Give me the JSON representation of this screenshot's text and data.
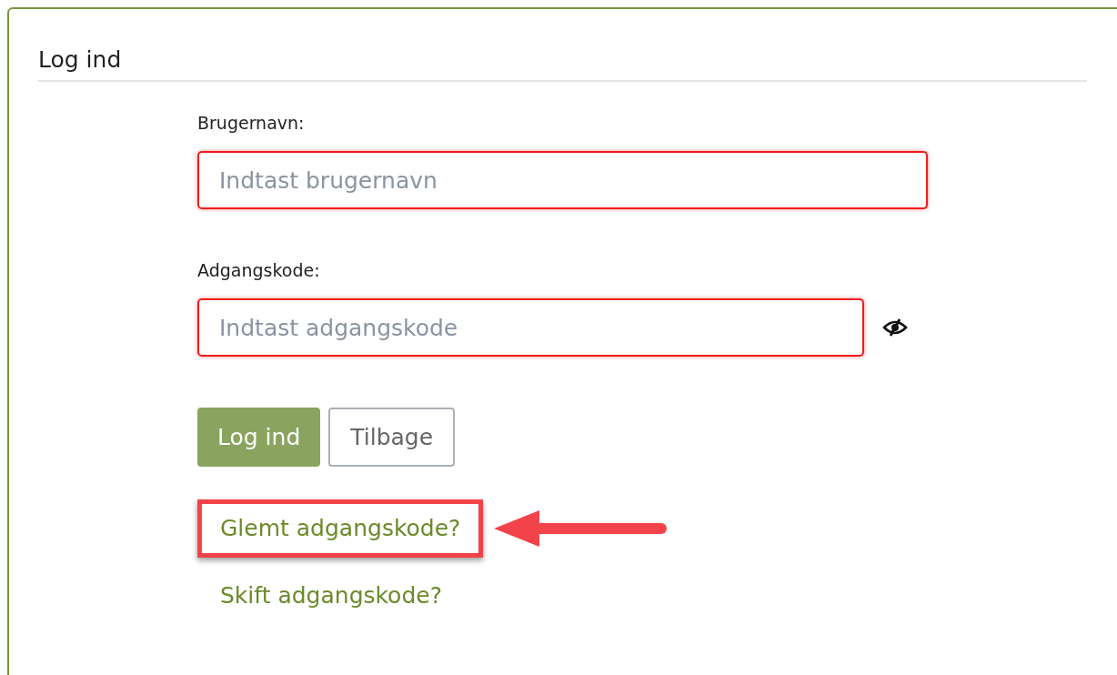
{
  "title": "Log ind",
  "fields": [
    {
      "label": "Brugernavn:",
      "placeholder": "Indtast brugernavn",
      "invalid": true,
      "kind": "text"
    },
    {
      "label": "Adgangskode:",
      "placeholder": "Indtast adgangskode",
      "invalid": true,
      "kind": "password"
    }
  ],
  "buttons": [
    {
      "label": "Log ind",
      "kind": "primary"
    },
    {
      "label": "Tilbage",
      "kind": "secondary"
    }
  ],
  "links": [
    {
      "label": "Glemt adgangskode?",
      "highlighted": true
    },
    {
      "label": "Skift adgangskode?",
      "highlighted": false
    }
  ]
}
